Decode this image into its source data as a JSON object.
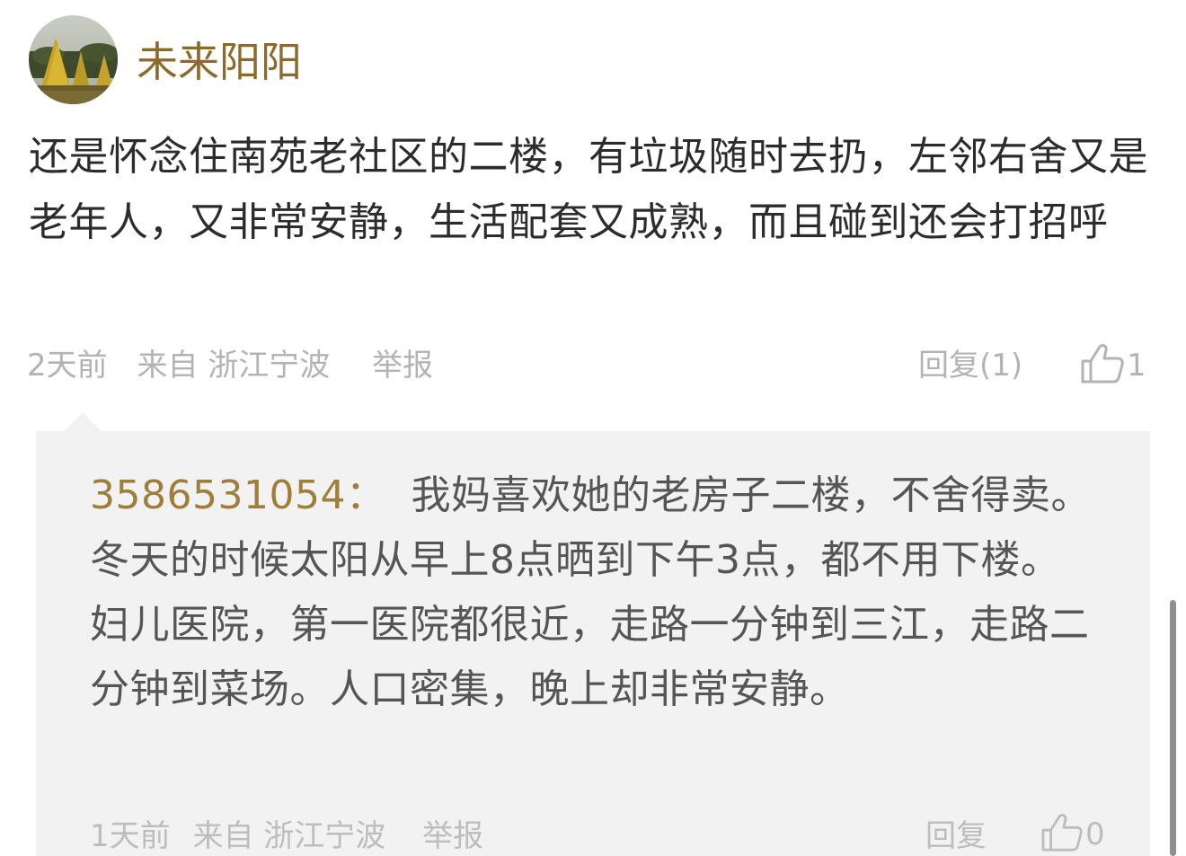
{
  "comment": {
    "username": "未来阳阳",
    "text": "还是怀念住南苑老社区的二楼，有垃圾随时去扔，左邻右舍又是老年人，又非常安静，生活配套又成熟，而且碰到还会打招呼",
    "time": "2天前",
    "source": "来自 浙江宁波",
    "report_label": "举报",
    "reply_label": "回复(1)",
    "like_count": "1",
    "avatar_icon": "avatar-trees-photo"
  },
  "reply": {
    "author": "3586531054",
    "separator": "：",
    "text": "我妈喜欢她的老房子二楼，不舍得卖。冬天的时候太阳从早上8点晒到下午3点，都不用下楼。妇儿医院，第一医院都很近，走路一分钟到三江，走路二分钟到菜场。人口密集，晚上却非常安静。",
    "time": "1天前",
    "source": "来自 浙江宁波",
    "report_label": "举报",
    "reply_label": "回复",
    "like_count": "0"
  },
  "colors": {
    "username": "#8c6a2a",
    "reply_author": "#a07e3a",
    "meta_text": "#b3b3b3",
    "reply_bg": "#f2f2f2",
    "body_text": "#2c2c2c",
    "reply_text": "#555555",
    "icon": "thumbs-up-icon"
  }
}
